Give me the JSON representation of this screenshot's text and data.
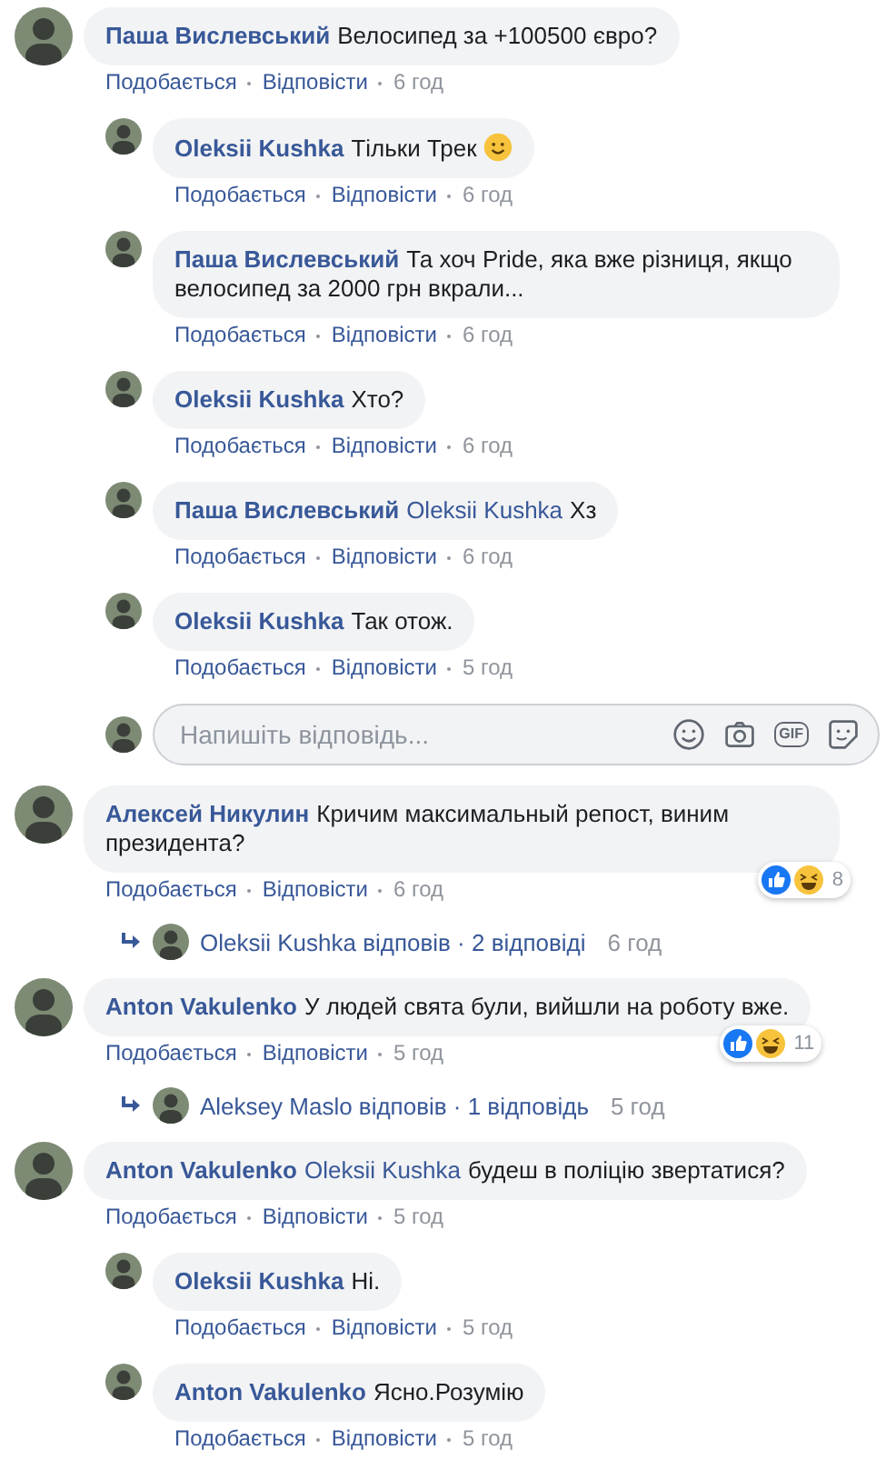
{
  "comments": [
    {
      "author": "Паша Вислевський",
      "text": "Велосипед за +100500 євро?",
      "actions": [
        "Подобається",
        "Відповісти"
      ],
      "time": "6 год",
      "replies": [
        {
          "author": "Oleksii Kushka",
          "text": "Тільки Трек",
          "emoji": true,
          "actions": [
            "Подобається",
            "Відповісти"
          ],
          "time": "6 год"
        },
        {
          "author": "Паша Вислевський",
          "text": "Та хоч Pride, яка вже різниця, якщо велосипед за 2000 грн вкрали...",
          "actions": [
            "Подобається",
            "Відповісти"
          ],
          "time": "6 год"
        },
        {
          "author": "Oleksii Kushka",
          "text": "Хто?",
          "actions": [
            "Подобається",
            "Відповісти"
          ],
          "time": "6 год"
        },
        {
          "author": "Паша Вислевський",
          "mention": "Oleksii Kushka",
          "text": "Хз",
          "actions": [
            "Подобається",
            "Відповісти"
          ],
          "time": "6 год"
        },
        {
          "author": "Oleksii Kushka",
          "text": "Так отож.",
          "actions": [
            "Подобається",
            "Відповісти"
          ],
          "time": "5 год"
        }
      ],
      "reply_input": {
        "placeholder": "Напишіть відповідь...",
        "gif_label": "GIF"
      }
    },
    {
      "author": "Алексей Никулин",
      "text": "Кричим максимальный репост, виним президента?",
      "actions": [
        "Подобається",
        "Відповісти"
      ],
      "time": "6 год",
      "reactions": {
        "count": "8"
      },
      "reply_summary": {
        "text": "Oleksii Kushka відповів · 2 відповіді",
        "time": "6 год"
      }
    },
    {
      "author": "Anton Vakulenko",
      "text": "У людей свята були, вийшли на роботу вже.",
      "actions": [
        "Подобається",
        "Відповісти"
      ],
      "time": "5 год",
      "reactions": {
        "count": "11"
      },
      "reply_summary": {
        "text": "Aleksey Maslo відповів · 1 відповідь",
        "time": "5 год"
      }
    },
    {
      "author": "Anton Vakulenko",
      "mention": "Oleksii Kushka",
      "text": "будеш в поліцію звертатися?",
      "actions": [
        "Подобається",
        "Відповісти"
      ],
      "time": "5 год",
      "replies": [
        {
          "author": "Oleksii Kushka",
          "text": "Ні.",
          "actions": [
            "Подобається",
            "Відповісти"
          ],
          "time": "5 год"
        },
        {
          "author": "Anton Vakulenko",
          "text": "Ясно.Розумію",
          "actions": [
            "Подобається",
            "Відповісти"
          ],
          "time": "5 год"
        }
      ]
    }
  ]
}
